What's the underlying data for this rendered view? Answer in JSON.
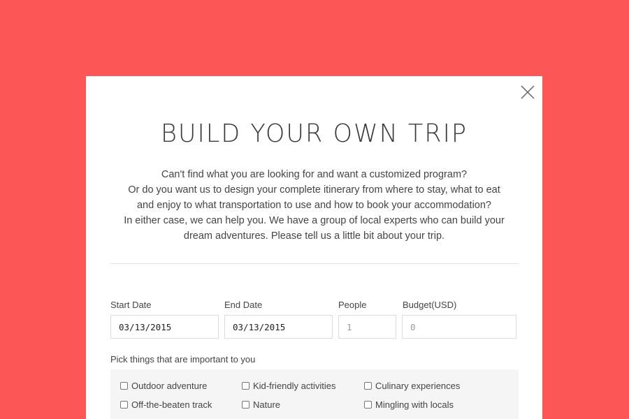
{
  "modal": {
    "title": "BUILD YOUR OWN TRIP",
    "intro_lines": [
      "Can't find what you are looking for and want a customized program?",
      "Or do you want us to design your complete itinerary from where to stay, what to eat",
      "and enjoy to what transportation to use and how to book your accommodation?",
      "In either case, we can help you. We have a group of local experts who can build your",
      "dream adventures. Please tell us a little bit about your trip."
    ],
    "close_icon": "close-icon"
  },
  "form": {
    "start_date": {
      "label": "Start Date",
      "value": "03/13/2015"
    },
    "end_date": {
      "label": "End Date",
      "value": "03/13/2015"
    },
    "people": {
      "label": "People",
      "placeholder": "1"
    },
    "budget": {
      "label": "Budget(USD)",
      "placeholder": "0"
    },
    "interests_label": "Pick things that are important to you",
    "interests": [
      "Outdoor adventure",
      "Kid-friendly activities",
      "Culinary experiences",
      "Off-the-beaten track",
      "Nature",
      "Mingling with locals"
    ]
  },
  "colors": {
    "background": "#fd5656",
    "modal": "#ffffff",
    "options_box": "#f5f5f5"
  }
}
